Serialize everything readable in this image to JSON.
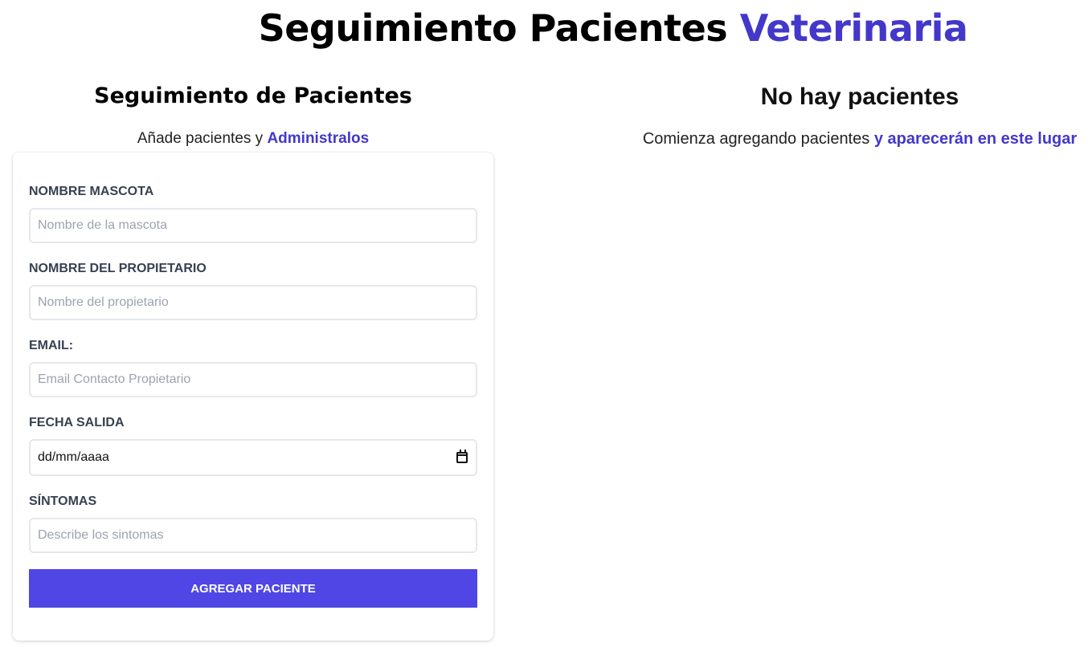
{
  "header": {
    "title_main": "Seguimiento Pacientes",
    "title_accent": "Veterinaria"
  },
  "form_section": {
    "heading": "Seguimiento de Pacientes",
    "subtitle_text": "Añade pacientes y",
    "subtitle_accent": "Administralos",
    "fields": {
      "pet_name": {
        "label": "Nombre Mascota",
        "placeholder": "Nombre de la mascota",
        "value": ""
      },
      "owner_name": {
        "label": "Nombre del Propietario",
        "placeholder": "Nombre del propietario",
        "value": ""
      },
      "email": {
        "label": "Email:",
        "placeholder": "Email Contacto Propietario",
        "value": ""
      },
      "discharge_date": {
        "label": "Fecha Salida",
        "placeholder": "dd/mm/aaaa"
      },
      "symptoms": {
        "label": "Síntomas",
        "placeholder": "Describe los sintomas",
        "value": ""
      }
    },
    "submit_label": "Agregar Paciente"
  },
  "patients_section": {
    "heading": "No hay pacientes",
    "subtitle_text": "Comienza agregando pacientes",
    "subtitle_accent": "y aparecerán en este lugar"
  },
  "colors": {
    "accent": "#4338ca",
    "button": "#4f46e5",
    "label": "#374151",
    "input_border": "#e5e7eb"
  },
  "icons": {
    "date_picker": "calendar-icon"
  }
}
